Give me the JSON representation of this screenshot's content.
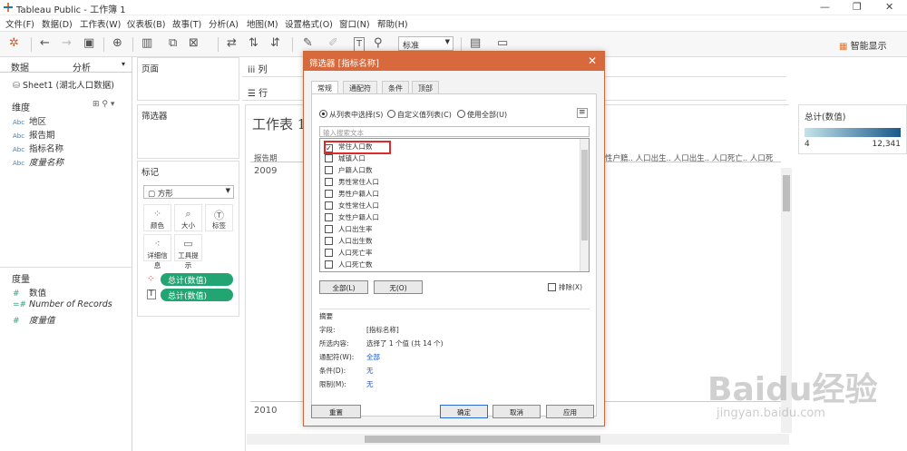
{
  "app": {
    "title": "Tableau Public - 工作簿 1"
  },
  "menu": [
    "文件(F)",
    "数据(D)",
    "工作表(W)",
    "仪表板(B)",
    "故事(T)",
    "分析(A)",
    "地图(M)",
    "设置格式(O)",
    "窗口(N)",
    "帮助(H)"
  ],
  "toolbar": {
    "standard_label": "标准",
    "smart_label": "智能显示"
  },
  "left": {
    "tabs": {
      "data": "数据",
      "analysis": "分析"
    },
    "datasource": "Sheet1 (湖北人口数据)",
    "dimensions_title": "维度",
    "dimensions": [
      {
        "type": "Abc",
        "name": "地区",
        "italic": false
      },
      {
        "type": "Abc",
        "name": "报告期",
        "italic": false
      },
      {
        "type": "Abc",
        "name": "指标名称",
        "italic": false
      },
      {
        "type": "Abc",
        "name": "度量名称",
        "italic": true
      }
    ],
    "measures_title": "度量",
    "measures": [
      {
        "name": "数值",
        "italic": false
      },
      {
        "name": "Number of Records",
        "italic": true
      },
      {
        "name": "度量值",
        "italic": true
      }
    ]
  },
  "middle": {
    "pages": "页面",
    "filters": "筛选器",
    "marks": "标记",
    "mark_type": "方形",
    "mark_buttons": [
      "颜色",
      "大小",
      "标签",
      "详细信息",
      "工具提示"
    ],
    "pills": [
      "总计(数值)",
      "总计(数值)"
    ]
  },
  "shelves": {
    "columns": "列",
    "rows": "行"
  },
  "viz": {
    "title": "工作表 1",
    "row_header": "报告期",
    "year1": "2009",
    "year2": "2010",
    "col_headers": "性户籍..  人口出生..  人口出生..  人口死亡..  人口死"
  },
  "legend": {
    "title": "总计(数值)",
    "min": "4",
    "max": "12,341",
    "colors": {
      "low": "#c4e3ea",
      "high": "#19598a"
    }
  },
  "dialog": {
    "title": "筛选器 [指标名称]",
    "tabs": [
      "常规",
      "通配符",
      "条件",
      "顶部"
    ],
    "radios": [
      "从列表中选择(S)",
      "自定义值列表(C)",
      "使用全部(U)"
    ],
    "search_placeholder": "输入搜索文本",
    "items": [
      {
        "label": "常住人口数",
        "checked": true
      },
      {
        "label": "城镇人口",
        "checked": false
      },
      {
        "label": "户籍人口数",
        "checked": false
      },
      {
        "label": "男性常住人口",
        "checked": false
      },
      {
        "label": "男性户籍人口",
        "checked": false
      },
      {
        "label": "女性常住人口",
        "checked": false
      },
      {
        "label": "女性户籍人口",
        "checked": false
      },
      {
        "label": "人口出生率",
        "checked": false
      },
      {
        "label": "人口出生数",
        "checked": false
      },
      {
        "label": "人口死亡率",
        "checked": false
      },
      {
        "label": "人口死亡数",
        "checked": false
      }
    ],
    "all_btn": "全部(L)",
    "none_btn": "无(O)",
    "exclude": "排除(X)",
    "summary_title": "摘要",
    "summary": [
      {
        "k": "字段:",
        "v": "[指标名称]",
        "blue": false
      },
      {
        "k": "所选内容:",
        "v": "选择了 1 个值 (共 14 个)",
        "blue": false
      },
      {
        "k": "通配符(W):",
        "v": "全部",
        "blue": true
      },
      {
        "k": "条件(D):",
        "v": "无",
        "blue": true
      },
      {
        "k": "限制(M):",
        "v": "无",
        "blue": true
      }
    ],
    "reset": "重置",
    "ok": "确定",
    "cancel": "取消",
    "apply": "应用"
  },
  "watermark": {
    "brand": "Baidu经验",
    "url": "jingyan.baidu.com"
  }
}
